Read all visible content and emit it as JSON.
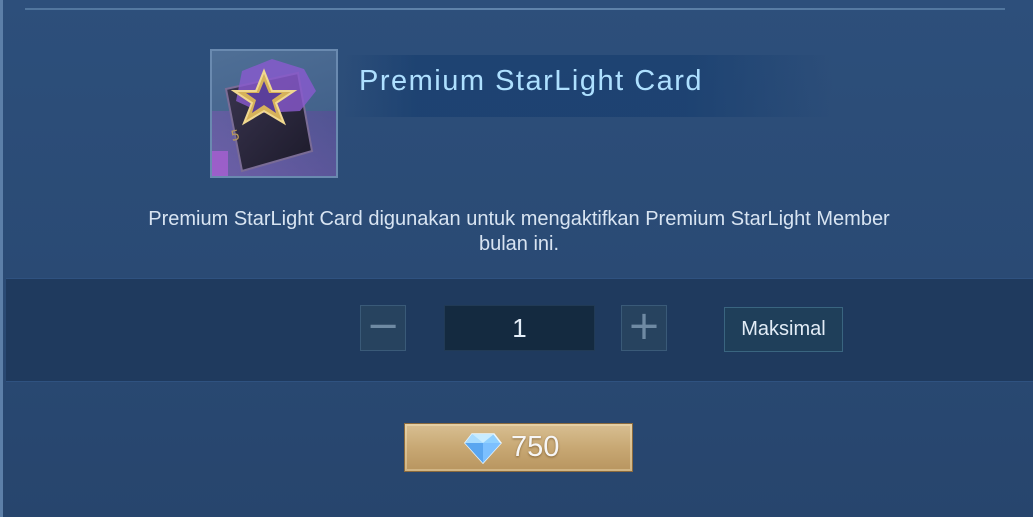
{
  "dialog": {
    "item_title": "Premium StarLight Card",
    "item_icon": "starlight-card-icon",
    "description_line1": "Premium StarLight Card digunakan untuk mengaktifkan Premium StarLight Member",
    "description_line2": "bulan ini."
  },
  "quantity": {
    "minus_label": "−",
    "value": "1",
    "plus_label": "+",
    "max_label": "Maksimal"
  },
  "purchase": {
    "currency_icon": "diamond-icon",
    "price": "750"
  },
  "colors": {
    "title": "#aee0ff",
    "panel": "#2d4f7b",
    "quantity_band": "#1f3a5e",
    "price_button": "#c8a874"
  }
}
